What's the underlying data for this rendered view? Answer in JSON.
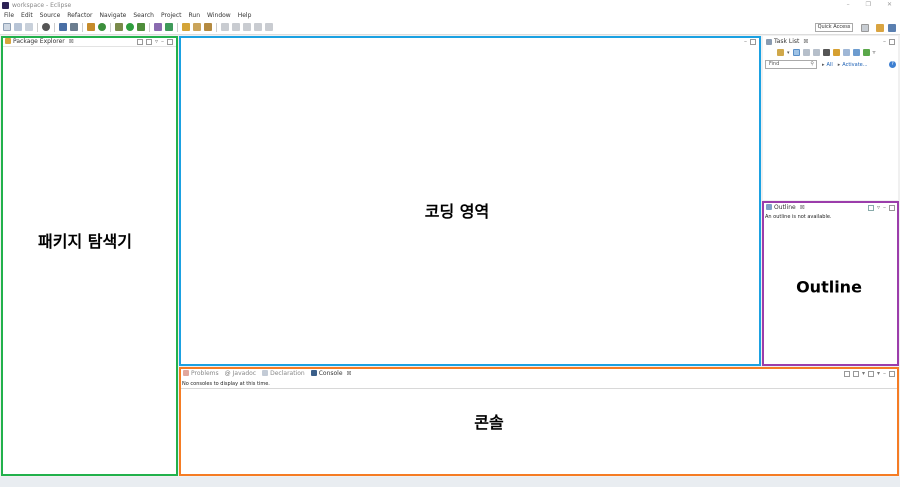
{
  "window": {
    "title": "workspace - Eclipse"
  },
  "menubar": {
    "items": [
      "File",
      "Edit",
      "Source",
      "Refactor",
      "Navigate",
      "Search",
      "Project",
      "Run",
      "Window",
      "Help"
    ]
  },
  "toolbar": {
    "quick_access": "Quick Access"
  },
  "package_explorer": {
    "tab_label": "Package Explorer",
    "annotation": "패키지 탐색기"
  },
  "editor": {
    "annotation": "코딩 영역"
  },
  "task_list": {
    "tab_label": "Task List",
    "find_placeholder": "Find",
    "filter_all": "All",
    "activate_label": "Activate..."
  },
  "outline": {
    "tab_label": "Outline",
    "message": "An outline is not available.",
    "annotation": "Outline"
  },
  "bottom": {
    "tabs": [
      "Problems",
      "Javadoc",
      "Declaration",
      "Console"
    ],
    "active_tab": "Console",
    "message": "No consoles to display at this time.",
    "annotation": "콘솔"
  },
  "colors": {
    "package_explorer_frame": "#22b14c",
    "editor_frame": "#1ba1e2",
    "outline_frame": "#9b3dab",
    "console_frame": "#f57c24"
  }
}
